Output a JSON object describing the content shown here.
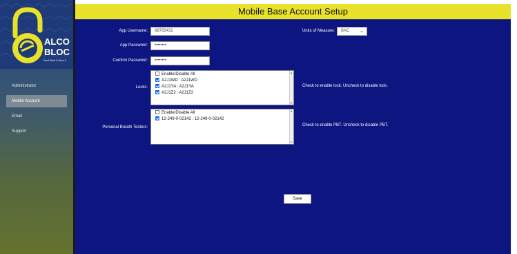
{
  "brand": {
    "line1": "ALCO",
    "line2": "BLOC",
    "tagline": "Don't Drink & Drive It",
    "accent": "#e9e22a"
  },
  "sidebar": {
    "items": [
      {
        "label": "Administrator"
      },
      {
        "label": "Mobile Account"
      },
      {
        "label": "Email"
      },
      {
        "label": "Support"
      }
    ]
  },
  "header": {
    "title": "Mobile Base Account Setup"
  },
  "form": {
    "username_label": "App Username:",
    "username_value": "98765432",
    "password_label": "App Password:",
    "password_value": "••••••••",
    "confirm_label": "Confirm Password:",
    "confirm_value": "••••••••",
    "units_label": "Units of Measure:",
    "units_value": "BAC"
  },
  "locks": {
    "label": "Locks:",
    "items": [
      {
        "label": "Enable/Disable All",
        "checked": false
      },
      {
        "label": "A2J1WD : A2J1WD",
        "checked": true
      },
      {
        "label": "A2J1YA : A2J1YA",
        "checked": true
      },
      {
        "label": "A2J1Z2 : A2J1Z2",
        "checked": true
      }
    ],
    "note": "Check to enable lock. Uncheck to disable lock."
  },
  "pbt": {
    "label": "Personal Breath Testers:",
    "items": [
      {
        "label": "Enable/Disable All",
        "checked": false
      },
      {
        "label": "12-249-0-02142 : 12-249-0-02142",
        "checked": true
      }
    ],
    "note": "Check to enable PBT. Uncheck to disable PBT."
  },
  "actions": {
    "save_label": "Save"
  },
  "colors": {
    "main_bg": "#0d1580",
    "header_bg": "#e9e22a",
    "checkbox": "#1e6fe0"
  }
}
